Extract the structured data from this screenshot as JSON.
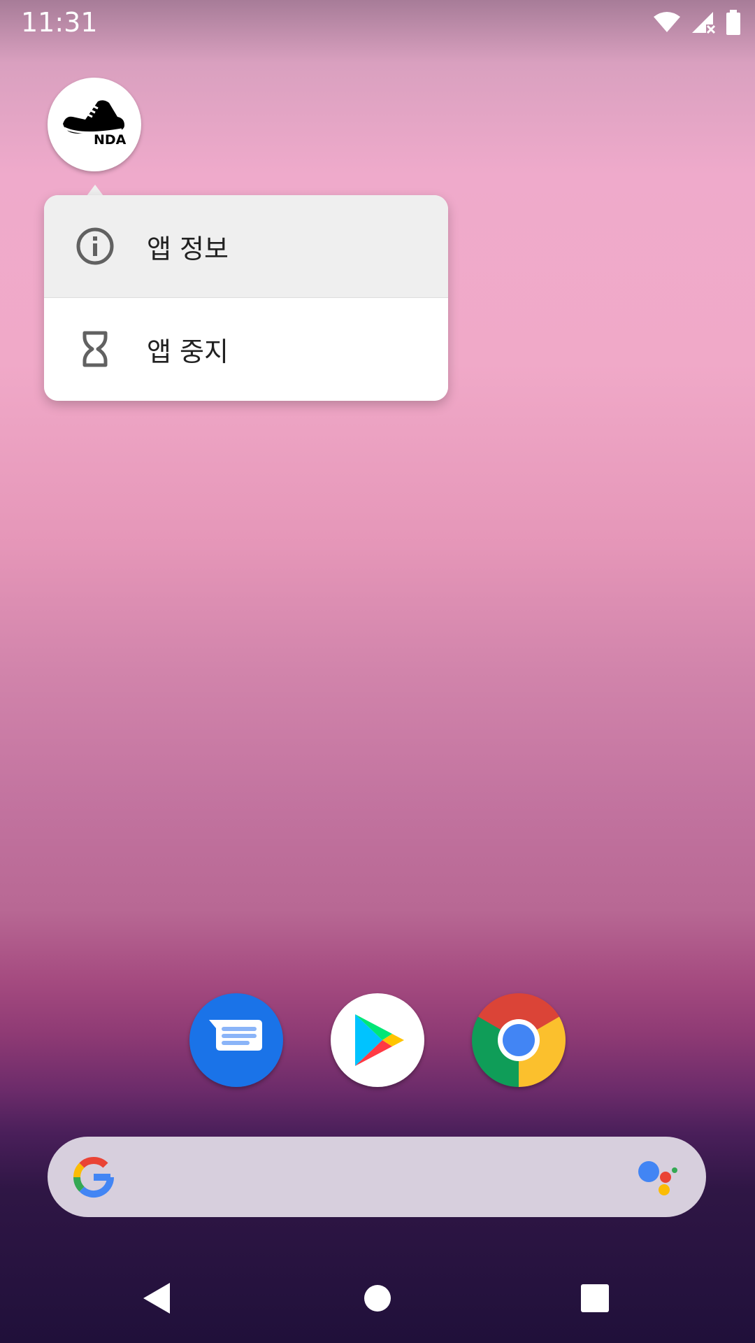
{
  "status_bar": {
    "time": "11:31",
    "icons": [
      "wifi-icon",
      "cellular-no-signal-icon",
      "battery-icon"
    ]
  },
  "home": {
    "app_icon": {
      "name": "nda-shoe-app-icon",
      "label_text": "NDA"
    }
  },
  "popup_menu": {
    "items": [
      {
        "label": "앱 정보",
        "icon": "info-icon"
      },
      {
        "label": "앱 중지",
        "icon": "hourglass-icon"
      }
    ]
  },
  "dock": {
    "apps": [
      "messages-app-icon",
      "play-store-app-icon",
      "chrome-app-icon"
    ]
  },
  "search_bar": {
    "left_icon": "google-g-icon",
    "right_icon": "assistant-icon"
  },
  "nav_bar": {
    "buttons": [
      "back-button",
      "home-button",
      "recents-button"
    ]
  },
  "colors": {
    "google_blue": "#4285F4",
    "google_red": "#EA4335",
    "google_yellow": "#FBBC05",
    "google_green": "#34A853",
    "messages_blue": "#1A73E8"
  }
}
